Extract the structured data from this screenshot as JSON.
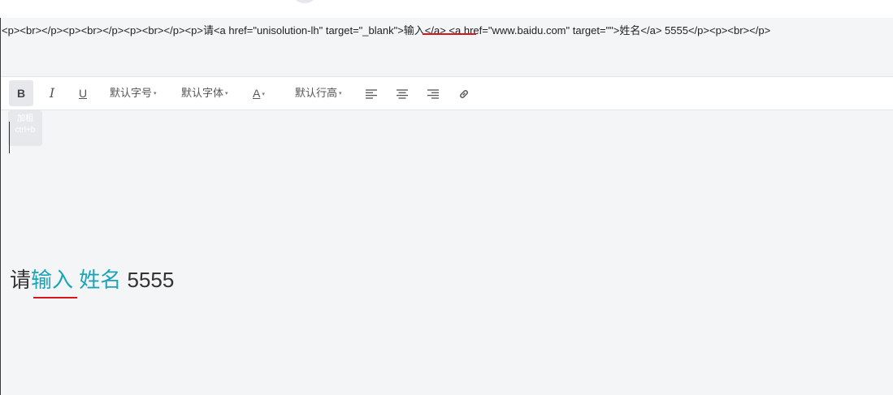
{
  "source": {
    "html_text": "<p><br></p><p><br></p><p><br></p><p>请<a href=\"unisolution-lh\" target=\"_blank\">输入</a> <a href=\"www.baidu.com\" target=\"\">姓名</a> 5555</p><p><br></p>"
  },
  "toolbar": {
    "bold_label": "B",
    "italic_label": "I",
    "underline_label": "U",
    "font_size_label": "默认字号",
    "font_family_label": "默认字体",
    "font_color_label": "A",
    "line_height_label": "默认行高",
    "caret": "▾"
  },
  "tooltip": {
    "title": "加粗",
    "shortcut": "ctrl+b"
  },
  "editor": {
    "prefix": "请",
    "link1": "输入",
    "space": " ",
    "link2": "姓名",
    "suffix": " 5555"
  },
  "colors": {
    "link": "#1ba4b8",
    "annotation_underline": "#d9161c"
  }
}
